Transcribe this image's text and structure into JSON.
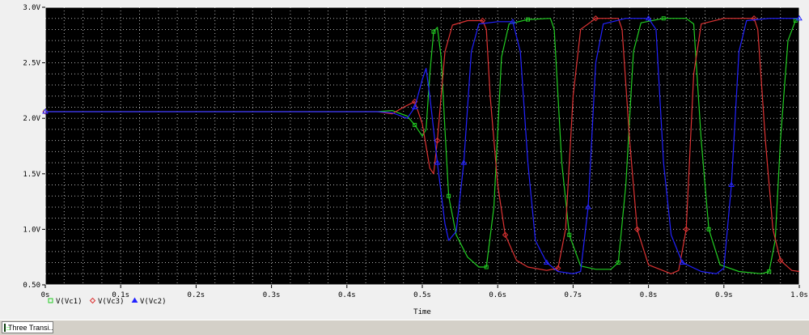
{
  "window": {
    "tab_label": "Three Transi..."
  },
  "colors": {
    "plot_bg": "#000000",
    "grid": "#b0b0b0",
    "axis": "#ffffff",
    "series": [
      "#22cc22",
      "#dd3333",
      "#2222ff"
    ]
  },
  "chart_data": {
    "type": "line",
    "xlabel": "Time",
    "ylabel": "",
    "xlim": [
      0,
      1.0
    ],
    "ylim": [
      0.5,
      3.0
    ],
    "x_ticks": [
      {
        "value": 0.0,
        "label": "0s"
      },
      {
        "value": 0.1,
        "label": "0.1s"
      },
      {
        "value": 0.2,
        "label": "0.2s"
      },
      {
        "value": 0.3,
        "label": "0.3s"
      },
      {
        "value": 0.4,
        "label": "0.4s"
      },
      {
        "value": 0.5,
        "label": "0.5s"
      },
      {
        "value": 0.6,
        "label": "0.6s"
      },
      {
        "value": 0.7,
        "label": "0.7s"
      },
      {
        "value": 0.8,
        "label": "0.8s"
      },
      {
        "value": 0.9,
        "label": "0.9s"
      },
      {
        "value": 1.0,
        "label": "1.0s"
      }
    ],
    "y_ticks": [
      {
        "value": 0.5,
        "label": "0.50"
      },
      {
        "value": 1.0,
        "label": "1.0V"
      },
      {
        "value": 1.5,
        "label": "1.5V"
      },
      {
        "value": 2.0,
        "label": "2.0V"
      },
      {
        "value": 2.5,
        "label": "2.5V"
      },
      {
        "value": 3.0,
        "label": "3.0V"
      }
    ],
    "grid": true,
    "legend_position": "bottom-left",
    "series": [
      {
        "name": "V(Vc1)",
        "color": "#22cc22",
        "marker": "square",
        "points": [
          [
            0,
            2.06
          ],
          [
            0.44,
            2.06
          ],
          [
            0.46,
            2.07
          ],
          [
            0.48,
            2.02
          ],
          [
            0.49,
            1.94
          ],
          [
            0.5,
            1.84
          ],
          [
            0.505,
            1.9
          ],
          [
            0.51,
            2.4
          ],
          [
            0.515,
            2.78
          ],
          [
            0.52,
            2.82
          ],
          [
            0.525,
            2.55
          ],
          [
            0.53,
            1.9
          ],
          [
            0.535,
            1.3
          ],
          [
            0.545,
            0.95
          ],
          [
            0.56,
            0.75
          ],
          [
            0.575,
            0.66
          ],
          [
            0.585,
            0.66
          ],
          [
            0.595,
            1.2
          ],
          [
            0.605,
            2.55
          ],
          [
            0.615,
            2.85
          ],
          [
            0.64,
            2.89
          ],
          [
            0.67,
            2.9
          ],
          [
            0.675,
            2.8
          ],
          [
            0.685,
            1.6
          ],
          [
            0.695,
            0.95
          ],
          [
            0.71,
            0.67
          ],
          [
            0.73,
            0.64
          ],
          [
            0.75,
            0.64
          ],
          [
            0.76,
            0.7
          ],
          [
            0.77,
            1.4
          ],
          [
            0.78,
            2.6
          ],
          [
            0.79,
            2.86
          ],
          [
            0.82,
            2.9
          ],
          [
            0.85,
            2.9
          ],
          [
            0.86,
            2.85
          ],
          [
            0.87,
            1.8
          ],
          [
            0.88,
            1.0
          ],
          [
            0.895,
            0.68
          ],
          [
            0.92,
            0.62
          ],
          [
            0.95,
            0.6
          ],
          [
            0.96,
            0.62
          ],
          [
            0.968,
            0.9
          ],
          [
            0.975,
            1.8
          ],
          [
            0.985,
            2.7
          ],
          [
            0.995,
            2.88
          ],
          [
            1.0,
            2.9
          ]
        ]
      },
      {
        "name": "V(Vc3)",
        "color": "#dd3333",
        "marker": "diamond",
        "points": [
          [
            0,
            2.06
          ],
          [
            0.44,
            2.06
          ],
          [
            0.46,
            2.04
          ],
          [
            0.475,
            2.1
          ],
          [
            0.49,
            2.15
          ],
          [
            0.5,
            1.95
          ],
          [
            0.51,
            1.55
          ],
          [
            0.515,
            1.5
          ],
          [
            0.52,
            1.8
          ],
          [
            0.53,
            2.6
          ],
          [
            0.54,
            2.84
          ],
          [
            0.56,
            2.88
          ],
          [
            0.58,
            2.88
          ],
          [
            0.585,
            2.8
          ],
          [
            0.59,
            2.2
          ],
          [
            0.6,
            1.4
          ],
          [
            0.61,
            0.95
          ],
          [
            0.625,
            0.72
          ],
          [
            0.64,
            0.66
          ],
          [
            0.665,
            0.63
          ],
          [
            0.68,
            0.65
          ],
          [
            0.69,
            1.0
          ],
          [
            0.7,
            2.2
          ],
          [
            0.71,
            2.8
          ],
          [
            0.73,
            2.9
          ],
          [
            0.76,
            2.9
          ],
          [
            0.765,
            2.8
          ],
          [
            0.775,
            1.8
          ],
          [
            0.785,
            1.0
          ],
          [
            0.8,
            0.68
          ],
          [
            0.83,
            0.6
          ],
          [
            0.84,
            0.63
          ],
          [
            0.85,
            1.0
          ],
          [
            0.86,
            2.4
          ],
          [
            0.87,
            2.85
          ],
          [
            0.9,
            2.9
          ],
          [
            0.94,
            2.9
          ],
          [
            0.945,
            2.8
          ],
          [
            0.955,
            1.8
          ],
          [
            0.965,
            1.0
          ],
          [
            0.975,
            0.72
          ],
          [
            0.99,
            0.63
          ],
          [
            1.0,
            0.62
          ]
        ]
      },
      {
        "name": "V(Vc2)",
        "color": "#2222ff",
        "marker": "triangle",
        "points": [
          [
            0,
            2.06
          ],
          [
            0.44,
            2.06
          ],
          [
            0.46,
            2.05
          ],
          [
            0.48,
            2.0
          ],
          [
            0.49,
            2.1
          ],
          [
            0.5,
            2.35
          ],
          [
            0.505,
            2.45
          ],
          [
            0.51,
            2.2
          ],
          [
            0.52,
            1.6
          ],
          [
            0.53,
            1.05
          ],
          [
            0.535,
            0.9
          ],
          [
            0.545,
            0.98
          ],
          [
            0.555,
            1.6
          ],
          [
            0.565,
            2.6
          ],
          [
            0.575,
            2.85
          ],
          [
            0.6,
            2.87
          ],
          [
            0.62,
            2.87
          ],
          [
            0.63,
            2.6
          ],
          [
            0.64,
            1.6
          ],
          [
            0.65,
            0.9
          ],
          [
            0.665,
            0.7
          ],
          [
            0.68,
            0.62
          ],
          [
            0.7,
            0.6
          ],
          [
            0.71,
            0.62
          ],
          [
            0.72,
            1.2
          ],
          [
            0.73,
            2.5
          ],
          [
            0.74,
            2.85
          ],
          [
            0.77,
            2.9
          ],
          [
            0.8,
            2.9
          ],
          [
            0.81,
            2.8
          ],
          [
            0.82,
            1.6
          ],
          [
            0.83,
            0.95
          ],
          [
            0.845,
            0.7
          ],
          [
            0.87,
            0.62
          ],
          [
            0.89,
            0.6
          ],
          [
            0.9,
            0.65
          ],
          [
            0.91,
            1.4
          ],
          [
            0.92,
            2.6
          ],
          [
            0.93,
            2.88
          ],
          [
            0.96,
            2.9
          ],
          [
            1.0,
            2.9
          ]
        ]
      }
    ]
  }
}
